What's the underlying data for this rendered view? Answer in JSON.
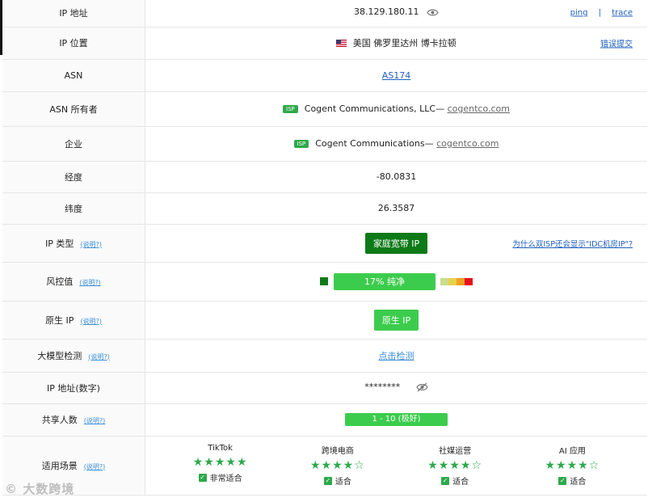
{
  "rows": {
    "ip": {
      "label": "IP 地址",
      "value": "38.129.180.11",
      "ping": "ping",
      "sep": "|",
      "trace": "trace"
    },
    "location": {
      "label": "IP 位置",
      "value": "美国 佛罗里达州 博卡拉顿",
      "report": "错误提交"
    },
    "asn": {
      "label": "ASN",
      "value": "AS174"
    },
    "asn_owner": {
      "label": "ASN 所有者",
      "badge": "ISP",
      "name": "Cogent Communications, LLC—",
      "domain": "cogentco.com"
    },
    "company": {
      "label": "企业",
      "badge": "ISP",
      "name": "Cogent Communications—",
      "domain": "cogentco.com"
    },
    "longitude": {
      "label": "经度",
      "value": "-80.0831"
    },
    "latitude": {
      "label": "纬度",
      "value": "26.3587"
    },
    "ip_type": {
      "label": "IP 类型",
      "help": "(说明?)",
      "value": "家庭宽带 IP",
      "question": "为什么双ISP还会显示\"IDC机房IP\"?"
    },
    "risk": {
      "label": "风控值",
      "help": "(说明?)",
      "value": "17%  纯净",
      "percent": 17
    },
    "native": {
      "label": "原生 IP",
      "help": "(说明?)",
      "value": "原生 IP"
    },
    "llm": {
      "label": "大模型检测",
      "help": "(说明?)",
      "value": "点击检测"
    },
    "ip_numeric": {
      "label": "IP 地址(数字)",
      "value": "********"
    },
    "shared": {
      "label": "共享人数",
      "help": "(说明?)",
      "value": "1 - 10 (极好)"
    },
    "scenes": {
      "label": "适用场景",
      "help": "(说明?)",
      "items": [
        {
          "name": "TikTok",
          "stars": "★★★★★",
          "fit": "非常适合"
        },
        {
          "name": "跨境电商",
          "stars": "★★★★☆",
          "fit": "适合"
        },
        {
          "name": "社媒运营",
          "stars": "★★★★☆",
          "fit": "适合"
        },
        {
          "name": "AI 应用",
          "stars": "★★★★☆",
          "fit": "适合"
        }
      ]
    }
  },
  "watermark": "大数跨境",
  "colors": {
    "green": "#3ccc4d",
    "dark_green": "#0e7a17",
    "link": "#1f5fbf"
  }
}
